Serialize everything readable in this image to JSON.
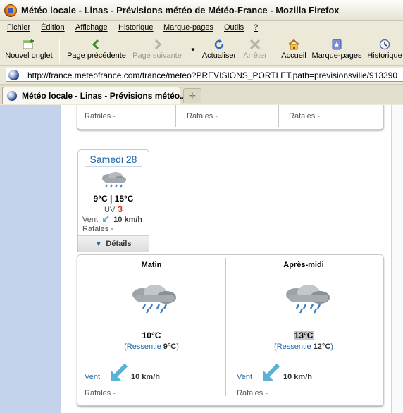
{
  "window": {
    "title": "Météo locale - Linas - Prévisions météo de Météo-France - Mozilla Firefox"
  },
  "menu": {
    "items": [
      "Fichier",
      "Édition",
      "Affichage",
      "Historique",
      "Marque-pages",
      "Outils",
      "?"
    ]
  },
  "toolbar": {
    "new_tab": "Nouvel onglet",
    "back": "Page précédente",
    "forward": "Page suivante",
    "reload": "Actualiser",
    "stop": "Arrêter",
    "home": "Accueil",
    "bookmarks": "Marque-pages",
    "history": "Historique"
  },
  "address": {
    "url": "http://france.meteofrance.com/france/meteo?PREVISIONS_PORTLET.path=previsionsville/913390"
  },
  "tabs": {
    "active_title": "Météo locale - Linas - Prévisions météo..."
  },
  "prev_strip": {
    "rafales": [
      "Rafales -",
      "Rafales -",
      "Rafales -"
    ]
  },
  "day": {
    "name": "Samedi 28",
    "temps": "9°C | 15°C",
    "uv_label": "UV",
    "uv_value": "3",
    "wind_label": "Vent",
    "wind_value": "10 km/h",
    "rafales": "Rafales -",
    "details": "Détails",
    "icon": "rain-cloud-icon"
  },
  "periods": [
    {
      "title": "Matin",
      "temp": "10°C",
      "ressentie_prefix": "(Ressentie ",
      "ressentie_value": "9°C",
      "ressentie_suffix": ")",
      "wind_label": "Vent",
      "wind_value": "10 km/h",
      "rafales": "Rafales -",
      "icon": "rain-cloud-icon"
    },
    {
      "title": "Après-midi",
      "temp": "13°C",
      "ressentie_prefix": "(Ressentie ",
      "ressentie_value": "12°C",
      "ressentie_suffix": ")",
      "wind_label": "Vent",
      "wind_value": "10 km/h",
      "rafales": "Rafales -",
      "icon": "rain-cloud-icon"
    }
  ],
  "colors": {
    "accent_blue": "#1d66a7",
    "uv_red": "#e0311b",
    "wind_arrow": "#5ab3d6",
    "left_panel": "#c5d2eb"
  }
}
